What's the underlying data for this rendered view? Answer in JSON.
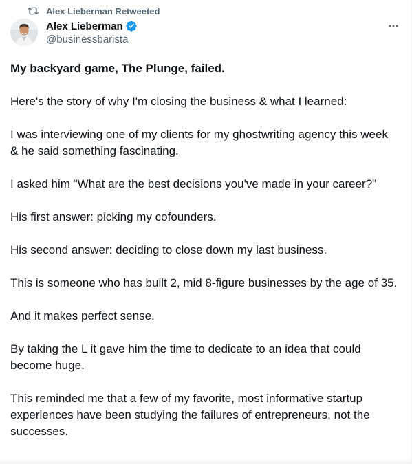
{
  "social_context": {
    "icon": "retweet-icon",
    "text": "Alex Lieberman Retweeted"
  },
  "author": {
    "display_name": "Alex Lieberman",
    "handle": "@businessbarista",
    "verified": true,
    "verified_color": "#1d9bf0",
    "avatar_icon": "avatar"
  },
  "more_button": {
    "icon": "more-horizontal-icon"
  },
  "tweet": {
    "paragraphs": [
      "My backyard game, The Plunge, failed.",
      "Here's the story of why I'm closing the business & what I learned:",
      "I was interviewing one of my clients for my ghostwriting agency this week & he said something fascinating.",
      "I asked him \"What are the best decisions you've made in your career?\"",
      "His first answer: picking my cofounders.",
      "His second answer: deciding to close down my last business.",
      "This is someone who has built 2, mid 8-figure businesses by the age of 35.",
      "And it makes perfect sense.",
      "By taking the L it gave him the time to dedicate to an idea that could become huge.",
      "This reminded me that a few of my favorite, most informative startup experiences have been studying the failures of entrepreneurs, not the successes."
    ]
  },
  "colors": {
    "text_primary": "#0f1419",
    "text_secondary": "#536471",
    "accent": "#1d9bf0"
  }
}
